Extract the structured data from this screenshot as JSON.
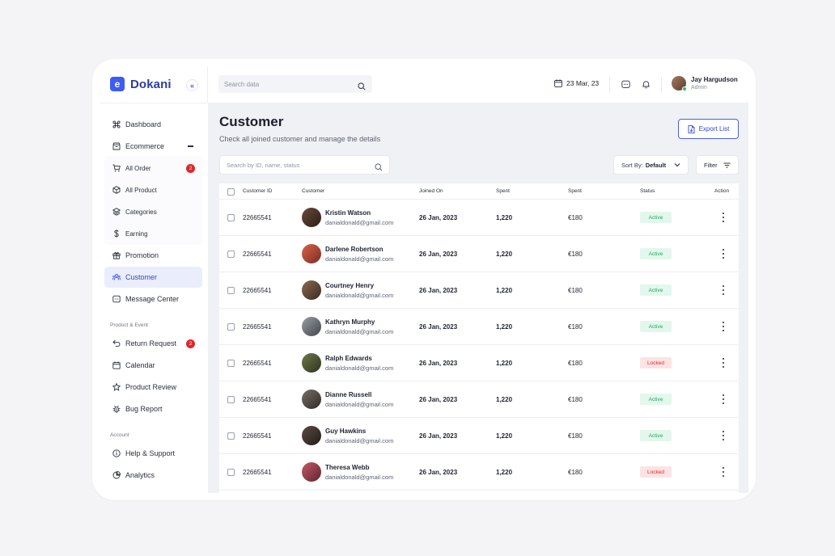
{
  "app": {
    "logo_letter": "e",
    "name": "Dokani"
  },
  "topbar": {
    "search_placeholder": "Search data",
    "date": "23 Mar, 23",
    "user": {
      "name": "Jay Hargudson",
      "role": "Admin"
    }
  },
  "sidebar": {
    "items": [
      {
        "label": "Dashboard",
        "icon": "command-icon"
      },
      {
        "label": "Ecommerce",
        "icon": "store-icon"
      },
      {
        "label": "All Order",
        "icon": "cart-icon",
        "badge": "2"
      },
      {
        "label": "All Product",
        "icon": "box-icon"
      },
      {
        "label": "Categories",
        "icon": "layers-icon"
      },
      {
        "label": "Earning",
        "icon": "dollar-icon"
      },
      {
        "label": "Promotion",
        "icon": "gift-icon"
      },
      {
        "label": "Customer",
        "icon": "users-icon"
      },
      {
        "label": "Message Center",
        "icon": "message-icon"
      },
      {
        "label": "Return Request",
        "icon": "return-icon",
        "badge": "2"
      },
      {
        "label": "Calendar",
        "icon": "calendar-icon"
      },
      {
        "label": "Product Review",
        "icon": "star-icon"
      },
      {
        "label": "Bug Report",
        "icon": "bug-icon"
      },
      {
        "label": "Help & Support",
        "icon": "info-icon"
      },
      {
        "label": "Analytics",
        "icon": "pie-chart-icon"
      }
    ],
    "sections": {
      "product_event": "Product & Event",
      "account": "Account"
    }
  },
  "main": {
    "title": "Customer",
    "subtitle": "Check all joined customer and manage the details",
    "export_label": "Export List",
    "table_search_placeholder": "Search by ID, name, status",
    "sort_prefix": "Sort By:",
    "sort_value": "Default",
    "filter_label": "Filter",
    "columns": [
      "Customer ID",
      "Customer",
      "Joined On",
      "Spent",
      "Spent",
      "Status",
      "Action"
    ],
    "rows": [
      {
        "id": "22665541",
        "name": "Kristin Watson",
        "email": "danialdonald@gmail.com",
        "joined": "26 Jan, 2023",
        "spent": "1,220",
        "spent_eur": "€180",
        "status": "Active"
      },
      {
        "id": "22665541",
        "name": "Darlene Robertson",
        "email": "danialdonald@gmail.com",
        "joined": "26 Jan, 2023",
        "spent": "1,220",
        "spent_eur": "€180",
        "status": "Active"
      },
      {
        "id": "22665541",
        "name": "Courtney Henry",
        "email": "danialdonald@gmail.com",
        "joined": "26 Jan, 2023",
        "spent": "1,220",
        "spent_eur": "€180",
        "status": "Active"
      },
      {
        "id": "22665541",
        "name": "Kathryn Murphy",
        "email": "danialdonald@gmail.com",
        "joined": "26 Jan, 2023",
        "spent": "1,220",
        "spent_eur": "€180",
        "status": "Active"
      },
      {
        "id": "22665541",
        "name": "Ralph Edwards",
        "email": "danialdonald@gmail.com",
        "joined": "26 Jan, 2023",
        "spent": "1,220",
        "spent_eur": "€180",
        "status": "Locked"
      },
      {
        "id": "22665541",
        "name": "Dianne Russell",
        "email": "danialdonald@gmail.com",
        "joined": "26 Jan, 2023",
        "spent": "1,220",
        "spent_eur": "€180",
        "status": "Active"
      },
      {
        "id": "22665541",
        "name": "Guy Hawkins",
        "email": "danialdonald@gmail.com",
        "joined": "26 Jan, 2023",
        "spent": "1,220",
        "spent_eur": "€180",
        "status": "Active"
      },
      {
        "id": "22665541",
        "name": "Theresa Webb",
        "email": "danialdonald@gmail.com",
        "joined": "26 Jan, 2023",
        "spent": "1,220",
        "spent_eur": "€180",
        "status": "Locked"
      }
    ]
  },
  "colors": {
    "accent": "#3d5bf5",
    "active_bg": "#e3f7ec",
    "active_text": "#21a863",
    "locked_bg": "#fde3e4",
    "locked_text": "#e0262b",
    "badge": "#e0262b"
  }
}
